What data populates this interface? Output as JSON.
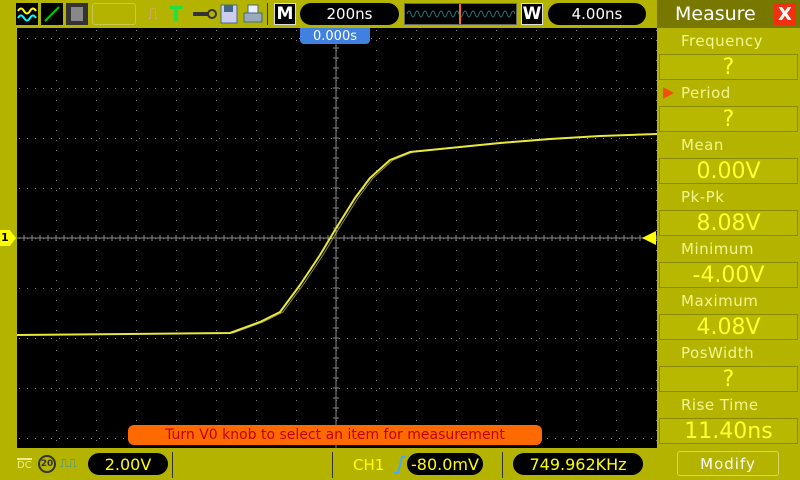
{
  "toolbar": {
    "timebase_mode": "M",
    "timebase": "200ns",
    "window_mode": "W",
    "window_timebase": "4.00ns",
    "trigger_position": "0.000s"
  },
  "panel": {
    "title": "Measure",
    "close": "X",
    "items": [
      {
        "label": "Frequency",
        "value": "?"
      },
      {
        "label": "Period",
        "value": "?"
      },
      {
        "label": "Mean",
        "value": "0.00V"
      },
      {
        "label": "Pk-Pk",
        "value": "8.08V"
      },
      {
        "label": "Minimum",
        "value": "-4.00V"
      },
      {
        "label": "Maximum",
        "value": "4.08V"
      },
      {
        "label": "PosWidth",
        "value": "?"
      },
      {
        "label": "Rise Time",
        "value": "11.40ns"
      }
    ],
    "selected": "Period",
    "modify": "Modify"
  },
  "status": {
    "message": "Turn V0 knob to select an item for measurement",
    "coupling": "DC",
    "bw_limit": "20",
    "ch1_scale": "2.00V",
    "trigger_source": "CH1",
    "trigger_level": "-80.0mV",
    "frequency": "749.962KHz",
    "channel_marker": "1"
  },
  "colors": {
    "trace": "#e8e840",
    "background": "#b4b400",
    "accent": "#ff6a00"
  }
}
